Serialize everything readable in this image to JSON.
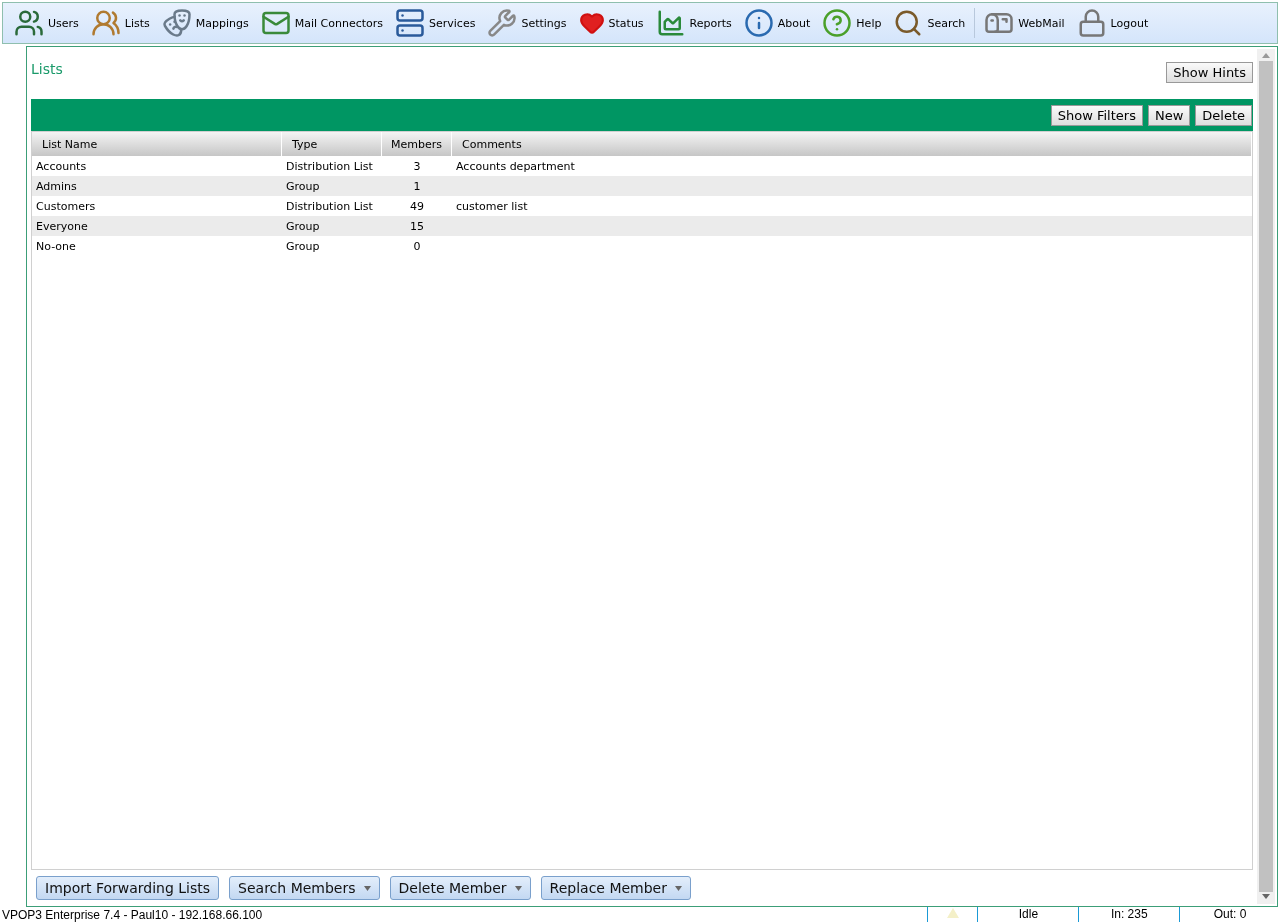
{
  "toolbar": [
    {
      "label": "Users"
    },
    {
      "label": "Lists"
    },
    {
      "label": "Mappings"
    },
    {
      "label": "Mail Connectors"
    },
    {
      "label": "Services"
    },
    {
      "label": "Settings"
    },
    {
      "label": "Status"
    },
    {
      "label": "Reports"
    },
    {
      "label": "About"
    },
    {
      "label": "Help"
    },
    {
      "label": "Search"
    },
    {
      "label": "WebMail"
    },
    {
      "label": "Logout"
    }
  ],
  "page": {
    "title": "Lists",
    "hint_button": "Show Hints"
  },
  "actions": [
    "Show Filters",
    "New",
    "Delete"
  ],
  "table": {
    "columns": [
      "List Name",
      "Type",
      "Members",
      "Comments"
    ],
    "rows": [
      {
        "cells": [
          "Accounts",
          "Distribution List",
          "3",
          "Accounts department"
        ]
      },
      {
        "cells": [
          "Admins",
          "Group",
          "1",
          ""
        ]
      },
      {
        "cells": [
          "Customers",
          "Distribution List",
          "49",
          "customer list"
        ]
      },
      {
        "cells": [
          "Everyone",
          "Group",
          "15",
          ""
        ]
      },
      {
        "cells": [
          "No-one",
          "Group",
          "0",
          ""
        ]
      }
    ]
  },
  "bottom_buttons": [
    {
      "label": "Import Forwarding Lists",
      "dropdown": false
    },
    {
      "label": "Search Members",
      "dropdown": true
    },
    {
      "label": "Delete Member",
      "dropdown": true
    },
    {
      "label": "Replace Member",
      "dropdown": true
    }
  ],
  "status_bar": {
    "product": "VPOP3 Enterprise 7.4 - Paul10 - 192.168.66.100",
    "state": "Idle",
    "in": "In: 235",
    "out": "Out: 0"
  }
}
